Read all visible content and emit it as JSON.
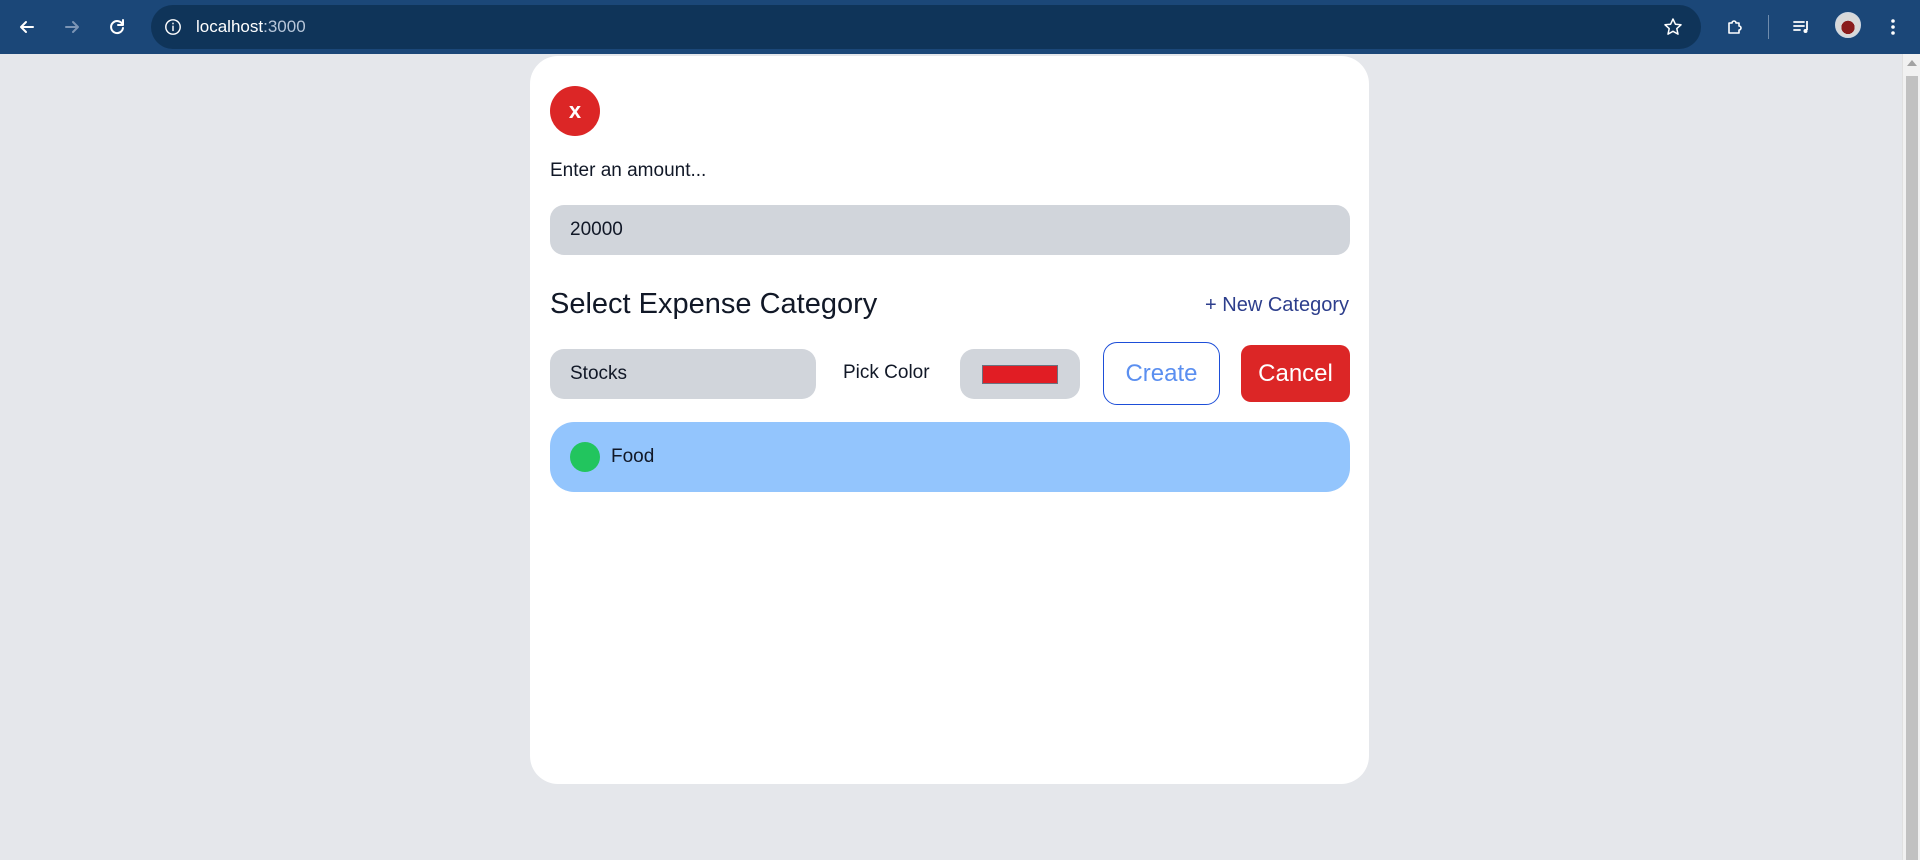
{
  "browser": {
    "url_host": "localhost",
    "url_port": ":3000"
  },
  "modal": {
    "close_label": "x",
    "amount_label": "Enter an amount...",
    "amount_value": "20000",
    "section_title": "Select Expense Category",
    "new_category_label": "+ New Category",
    "new_category_name": "Stocks",
    "pick_color_label": "Pick Color",
    "picked_color": "#e11d24",
    "create_label": "Create",
    "cancel_label": "Cancel",
    "categories": [
      {
        "name": "Food",
        "color": "#22c55e"
      }
    ]
  }
}
